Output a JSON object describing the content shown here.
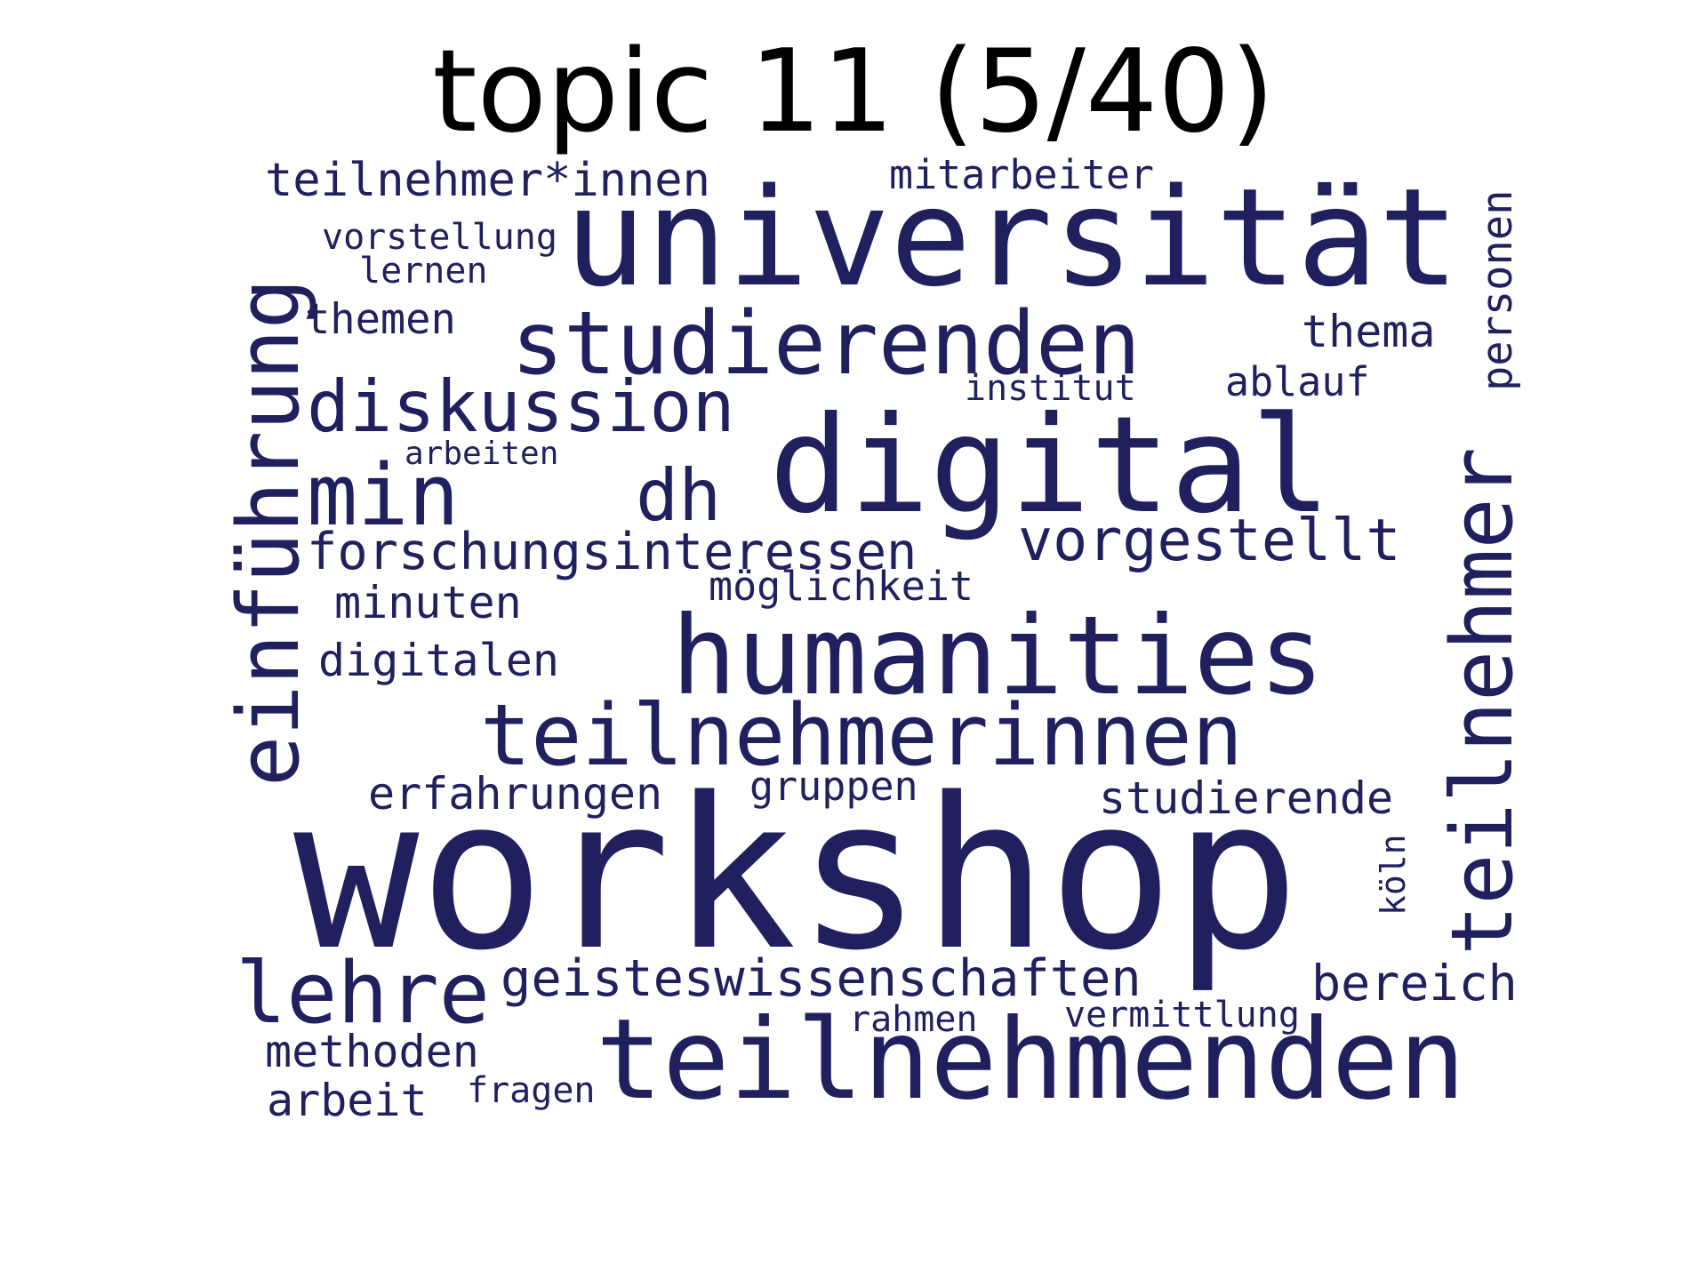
{
  "title": "topic 11 (5/40)",
  "word_color": "#20205f",
  "words": [
    "workshop",
    "teilnehmenden",
    "digital",
    "universität",
    "humanities",
    "teilnehmerinnen",
    "studierenden",
    "teilnehmer",
    "einführung",
    "lehre",
    "diskussion",
    "min",
    "dh",
    "vorgestellt",
    "forschungsinteressen",
    "geisteswissenschaften",
    "teilnehmer*innen",
    "bereich",
    "studierende",
    "methoden",
    "arbeit",
    "erfahrungen",
    "digitalen",
    "minuten",
    "thema",
    "themen",
    "ablauf",
    "möglichkeit",
    "gruppen",
    "mitarbeiter",
    "personen",
    "vorstellung",
    "lernen",
    "institut",
    "arbeiten",
    "fragen",
    "rahmen",
    "vermittlung",
    "köln"
  ]
}
